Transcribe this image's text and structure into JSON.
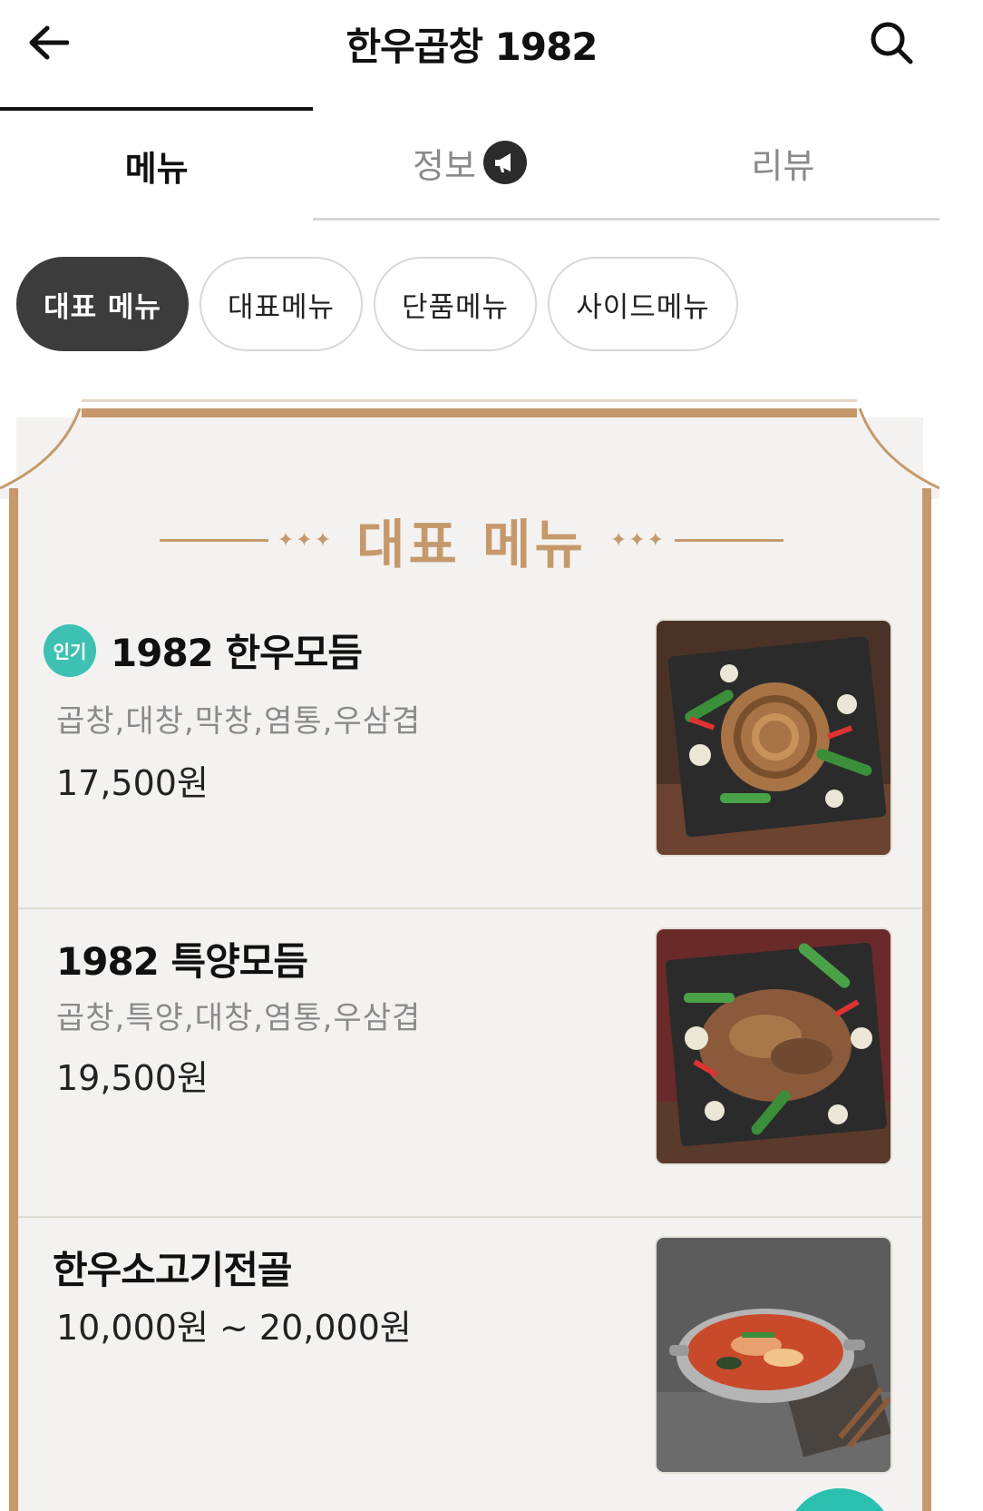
{
  "header": {
    "title": "한우곱창 1982",
    "back_icon": "arrow-left-icon",
    "search_icon": "search-icon"
  },
  "tabs": [
    {
      "label": "메뉴",
      "active": true
    },
    {
      "label": "정보",
      "active": false,
      "icon": "megaphone-icon"
    },
    {
      "label": "리뷰",
      "active": false
    }
  ],
  "chips": [
    {
      "label": "대표 메뉴",
      "active": true
    },
    {
      "label": "대표메뉴",
      "active": false
    },
    {
      "label": "단품메뉴",
      "active": false
    },
    {
      "label": "사이드메뉴",
      "active": false
    }
  ],
  "board": {
    "title": "대표 메뉴",
    "deco": "✦✦✦",
    "accent_color": "#c5996b"
  },
  "menu_items": [
    {
      "badge": "인기",
      "name": "1982 한우모듬",
      "desc": "곱창,대창,막창,염통,우삼겹",
      "price": "17,500원"
    },
    {
      "name": "1982 특양모듬",
      "desc": "곱창,특양,대창,염통,우삼겹",
      "price": "19,500원"
    },
    {
      "name": "한우소고기전골",
      "price": "10,000원 ~ 20,000원"
    }
  ],
  "colors": {
    "badge": "#3ec1b3",
    "chip_active": "#3c3c3c"
  }
}
